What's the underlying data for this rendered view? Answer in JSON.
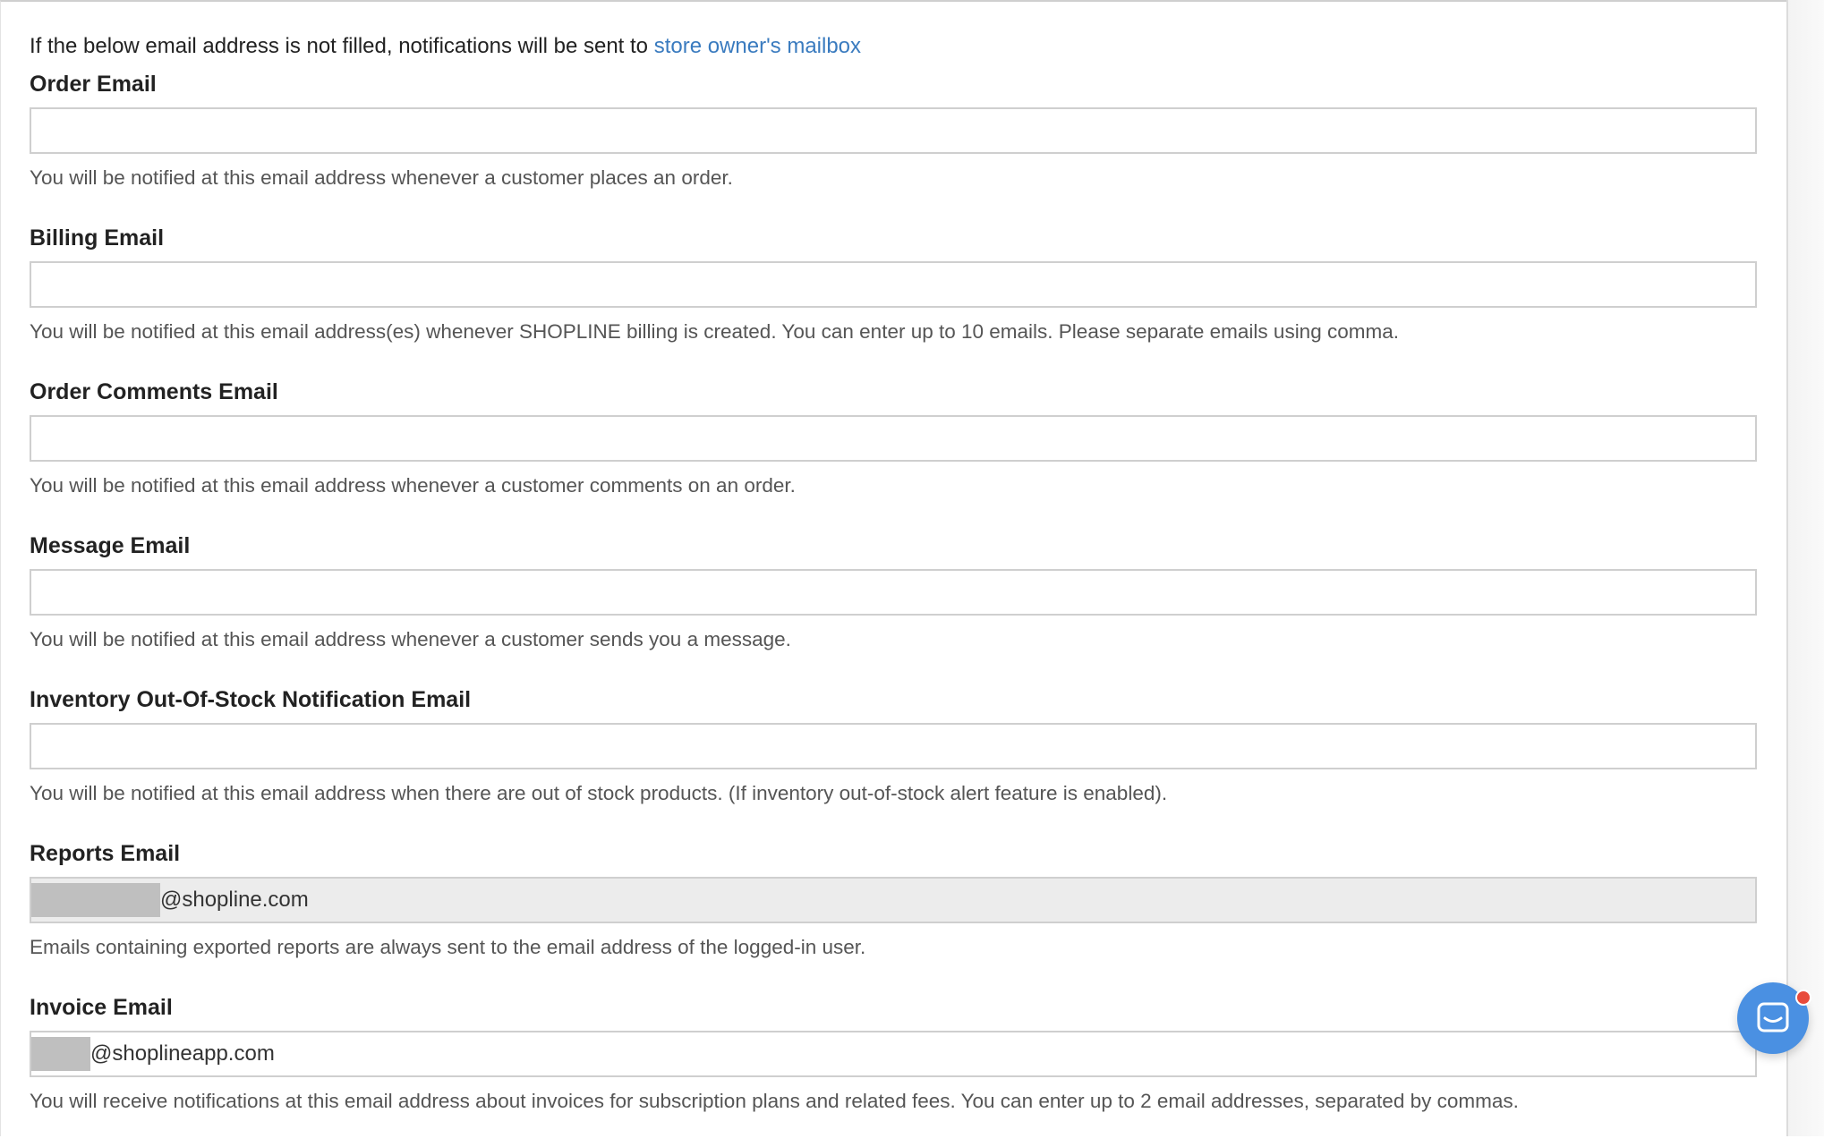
{
  "intro": {
    "text": "If the below email address is not filled, notifications will be sent to ",
    "link": "store owner's mailbox"
  },
  "fields": [
    {
      "label": "Order Email",
      "value": "",
      "help": "You will be notified at this email address whenever a customer places an order."
    },
    {
      "label": "Billing Email",
      "value": "",
      "help": "You will be notified at this email address(es) whenever SHOPLINE billing is created. You can enter up to 10 emails. Please separate emails using comma."
    },
    {
      "label": "Order Comments Email",
      "value": "",
      "help": "You will be notified at this email address whenever a customer comments on an order."
    },
    {
      "label": "Message Email",
      "value": "",
      "help": "You will be notified at this email address whenever a customer sends you a message."
    },
    {
      "label": "Inventory Out-Of-Stock Notification Email",
      "value": "",
      "help": "You will be notified at this email address when there are out of stock products. (If inventory out-of-stock alert feature is enabled)."
    },
    {
      "label": "Reports Email",
      "value": "@shopline.com",
      "help": "Emails containing exported reports are always sent to the email address of the logged-in user."
    },
    {
      "label": "Invoice Email",
      "value": "@shoplineapp.com",
      "help": "You will receive notifications at this email address about invoices for subscription plans and related fees. You can enter up to 2 email addresses, separated by commas."
    }
  ],
  "colors": {
    "link": "#3a7bbf",
    "chat_button": "#4a90e2",
    "notification_dot": "#e84b3c",
    "disabled_input": "#ececec"
  },
  "icons": {
    "chat": "chat-bubble-icon"
  }
}
